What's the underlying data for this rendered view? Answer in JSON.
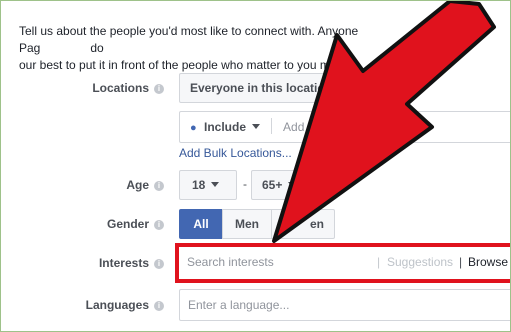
{
  "intro": {
    "line1": "Tell us about the people you'd most like to connect with. Anyone",
    "line1_tail": "find your Pag",
    "line1_end": "do",
    "line2": "our best to put it in front of the people who matter to you most."
  },
  "locations": {
    "label": "Locations",
    "selected": "Everyone in this location",
    "include": "Include",
    "add_placeholder": "Add loc",
    "bulk_link": "Add Bulk Locations..."
  },
  "age": {
    "label": "Age",
    "min": "18",
    "separator": "-",
    "max": "65+"
  },
  "gender": {
    "label": "Gender",
    "options": [
      "All",
      "Men",
      "Women"
    ],
    "visible_women": "en",
    "selected": "All"
  },
  "interests": {
    "label": "Interests",
    "placeholder": "Search interests",
    "suggestions": "Suggestions",
    "divider": "|",
    "browse": "Browse"
  },
  "languages": {
    "label": "Languages",
    "placeholder": "Enter a language..."
  },
  "colors": {
    "annotation_red": "#e0121d",
    "accent_blue": "#4267b2",
    "frame_green": "#9ec28a"
  },
  "icons": [
    "help-icon",
    "location-pin-icon",
    "chevron-down-icon",
    "annotation-arrow-icon"
  ]
}
